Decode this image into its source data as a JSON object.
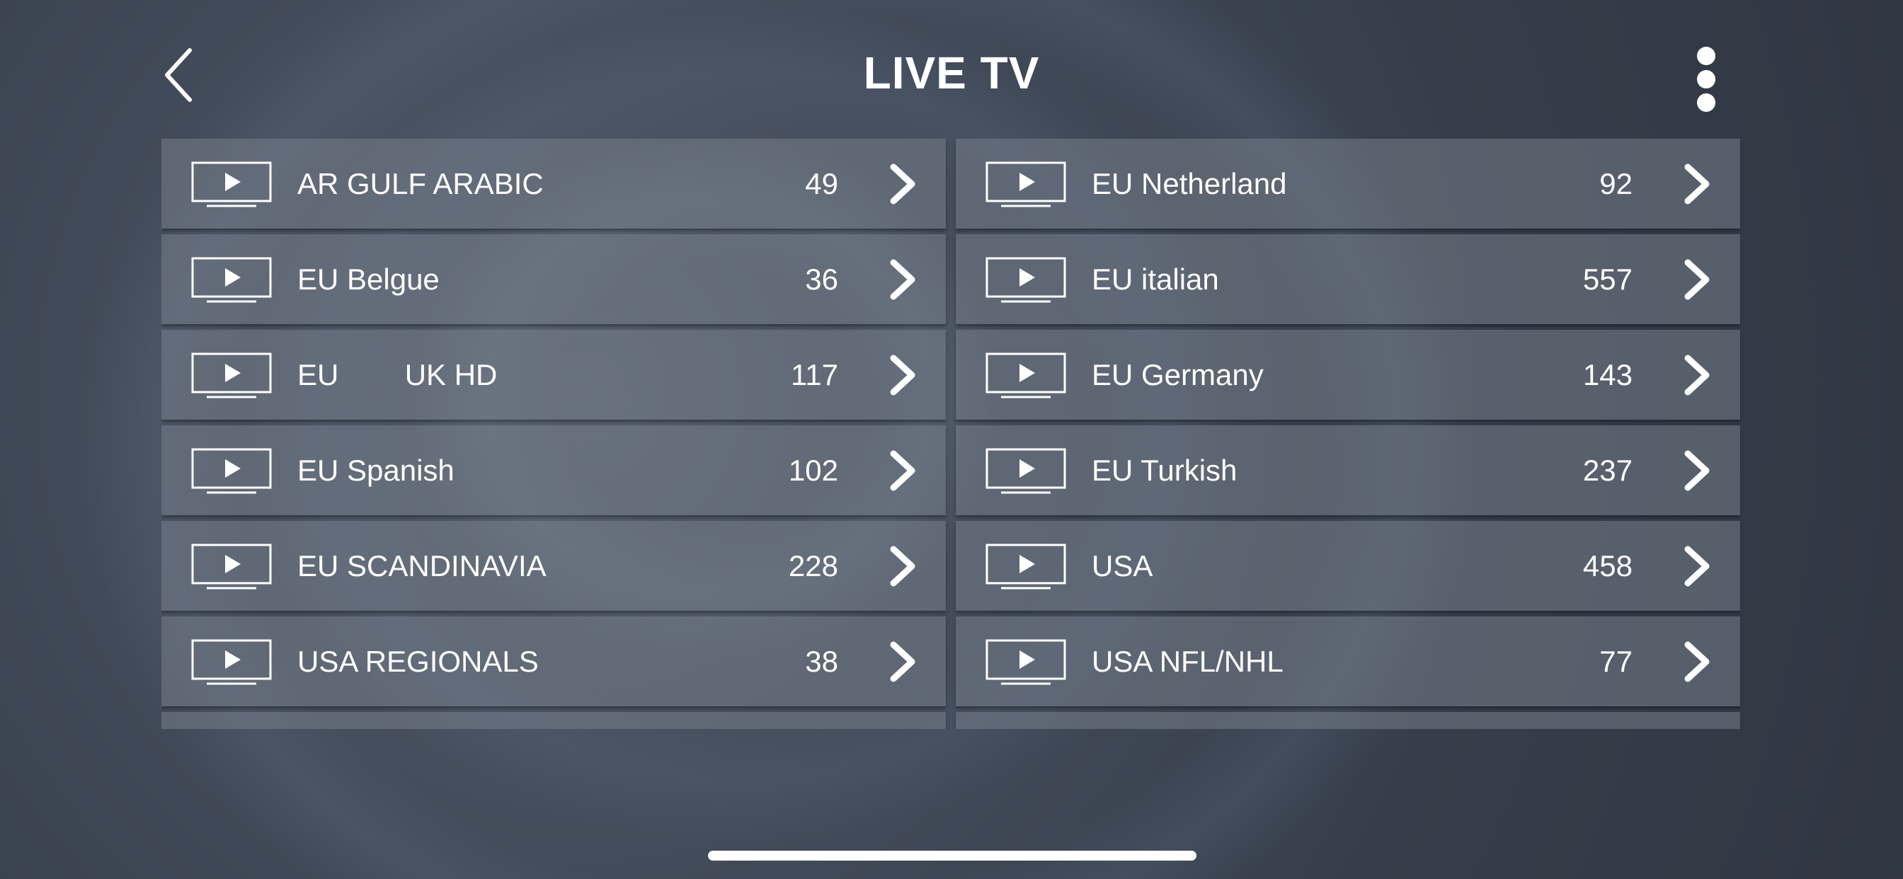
{
  "header": {
    "title": "LIVE TV",
    "back_icon": "chevron-left-icon",
    "menu_icon": "more-vertical-icon"
  },
  "categories": [
    {
      "label": "AR GULF ARABIC",
      "count": "49"
    },
    {
      "label": "EU Netherland",
      "count": "92"
    },
    {
      "label": "EU Belgue",
      "count": "36"
    },
    {
      "label": "EU italian",
      "count": "557"
    },
    {
      "label": "EU        UK HD",
      "count": "117"
    },
    {
      "label": "EU Germany",
      "count": "143"
    },
    {
      "label": "EU Spanish",
      "count": "102"
    },
    {
      "label": "EU Turkish",
      "count": "237"
    },
    {
      "label": "EU SCANDINAVIA",
      "count": "228"
    },
    {
      "label": "USA",
      "count": "458"
    },
    {
      "label": "USA REGIONALS",
      "count": "38"
    },
    {
      "label": "USA NFL/NHL",
      "count": "77"
    }
  ],
  "row_icon": "tv-play-icon",
  "row_arrow_icon": "chevron-right-icon",
  "colors": {
    "background": "#3d4654",
    "row_background": "#5d6672",
    "text": "#ffffff"
  }
}
